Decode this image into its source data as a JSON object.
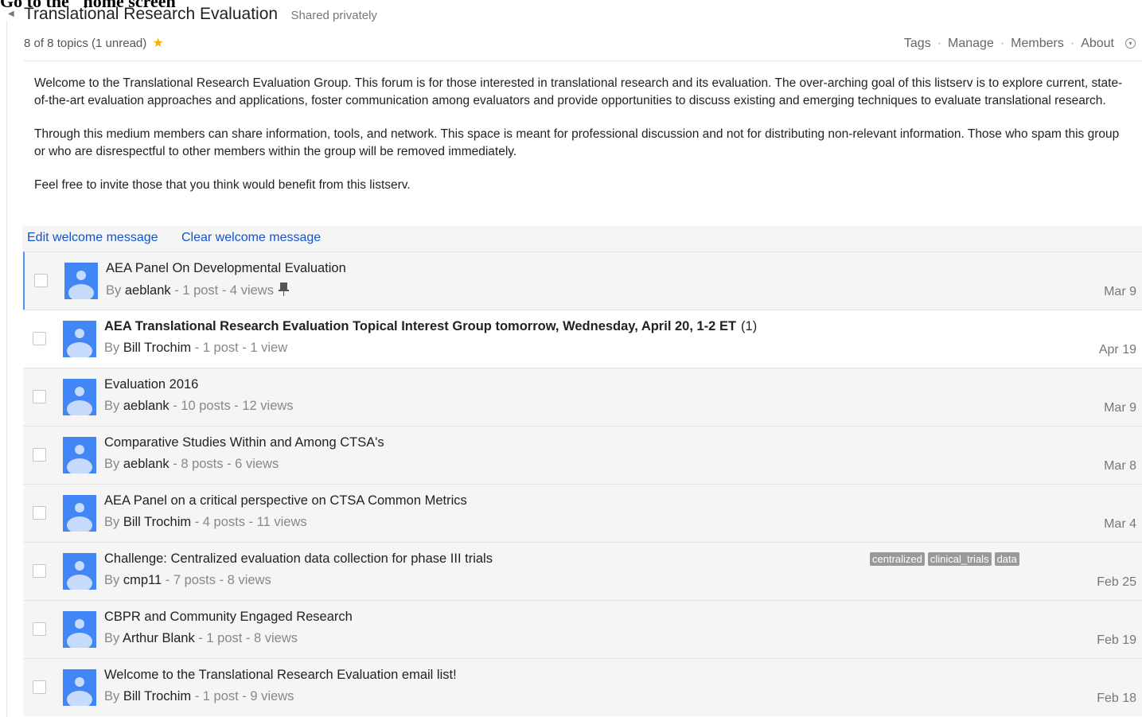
{
  "overlay_caption": "Go to the \"home screen\"",
  "group": {
    "title": "Translational Research Evaluation",
    "sharing": "Shared privately",
    "topic_count": "8 of 8 topics (1 unread)"
  },
  "nav": [
    "Tags",
    "Manage",
    "Members",
    "About"
  ],
  "welcome": {
    "paragraphs": [
      "Welcome to the Translational Research Evaluation Group. This forum is for those interested in translational research and its evaluation. The over-arching goal of this listserv is to explore current, state-of-the-art evaluation approaches and applications, foster communication among evaluators and provide opportunities to discuss existing and emerging techniques to evaluate translational research.",
      "Through this medium members can share information, tools, and network. This space is meant for professional discussion and not for distributing non-relevant information. Those who spam this group or who are disrespectful to other members within the group will be removed immediately.",
      "Feel free to invite those that you think would benefit from this listserv."
    ],
    "edit_label": "Edit welcome message",
    "clear_label": "Clear welcome message"
  },
  "topics": [
    {
      "subject": "AEA Panel On Developmental Evaluation",
      "unread_count": "",
      "author": "aeblank",
      "stats": " - 1 post - 4 views",
      "date": "Mar 9",
      "pinned": true,
      "unread": false,
      "selected": true,
      "tags": []
    },
    {
      "subject": "AEA Translational Research Evaluation Topical Interest Group tomorrow, Wednesday, April 20, 1-2 ET",
      "unread_count": "(1)",
      "author": "Bill Trochim",
      "stats": " - 1 post - 1 view",
      "date": "Apr 19",
      "pinned": false,
      "unread": true,
      "selected": false,
      "tags": []
    },
    {
      "subject": "Evaluation 2016",
      "unread_count": "",
      "author": "aeblank",
      "stats": " - 10 posts - 12 views",
      "date": "Mar 9",
      "pinned": false,
      "unread": false,
      "selected": false,
      "tags": []
    },
    {
      "subject": "Comparative Studies Within and Among CTSA's",
      "unread_count": "",
      "author": "aeblank",
      "stats": " - 8 posts - 6 views",
      "date": "Mar 8",
      "pinned": false,
      "unread": false,
      "selected": false,
      "tags": []
    },
    {
      "subject": "AEA Panel on a critical perspective on CTSA Common Metrics",
      "unread_count": "",
      "author": "Bill Trochim",
      "stats": " - 4 posts - 11 views",
      "date": "Mar 4",
      "pinned": false,
      "unread": false,
      "selected": false,
      "tags": []
    },
    {
      "subject": "Challenge: Centralized evaluation data collection for phase III trials",
      "unread_count": "",
      "author": "cmp11",
      "stats": " - 7 posts - 8 views",
      "date": "Feb 25",
      "pinned": false,
      "unread": false,
      "selected": false,
      "tags": [
        "centralized",
        "clinical_trials",
        "data"
      ]
    },
    {
      "subject": "CBPR and Community Engaged Research",
      "unread_count": "",
      "author": "Arthur Blank",
      "stats": " - 1 post - 8 views",
      "date": "Feb 19",
      "pinned": false,
      "unread": false,
      "selected": false,
      "tags": []
    },
    {
      "subject": "Welcome to the Translational Research Evaluation email list!",
      "unread_count": "",
      "author": "Bill Trochim",
      "stats": " - 1 post - 9 views",
      "date": "Feb 18",
      "pinned": false,
      "unread": false,
      "selected": false,
      "tags": []
    }
  ],
  "colors": {
    "link": "#1155cc",
    "star": "#f4b400",
    "avatar": "#4285f4",
    "selected_bar": "#4d90fe",
    "tag_bg": "#999999"
  },
  "icons": {
    "back": "triangle-left-icon",
    "star": "star-icon",
    "pin": "pin-icon",
    "avatar": "default-avatar-icon",
    "menu": "circle-chevron-down-icon"
  }
}
